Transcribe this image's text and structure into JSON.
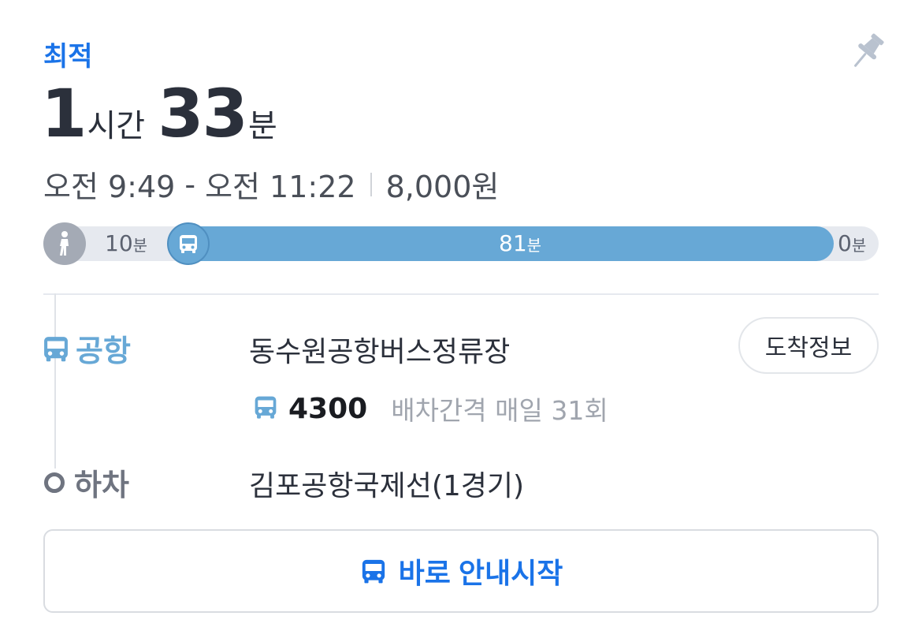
{
  "route_option": {
    "tag": "최적",
    "duration": {
      "hours": "1",
      "hours_unit": "시간",
      "minutes": "33",
      "minutes_unit": "분"
    },
    "depart": "오전 9:49",
    "arrive": "오전 11:22",
    "time_separator": "-",
    "fare": "8,000원"
  },
  "segments": {
    "walk": {
      "value": "10",
      "unit": "분",
      "icon": "walk-icon",
      "minutes": 10
    },
    "bus": {
      "value": "81",
      "unit": "분",
      "icon": "bus-icon",
      "minutes": 81
    },
    "final": {
      "value": "0",
      "unit": "분",
      "minutes": 0
    }
  },
  "board": {
    "type_label": "공항",
    "stop_name": "동수원공항버스정류장",
    "arrival_button": "도착정보",
    "route_number": "4300",
    "frequency": "배차간격 매일 31회"
  },
  "alight": {
    "type_label": "하차",
    "stop_name": "김포공항국제선(1경기)"
  },
  "start_button": "바로 안내시작",
  "colors": {
    "accent": "#1a73e8",
    "bus": "#67a8d6",
    "walk": "#a4aab5",
    "text": "#2b303b"
  }
}
